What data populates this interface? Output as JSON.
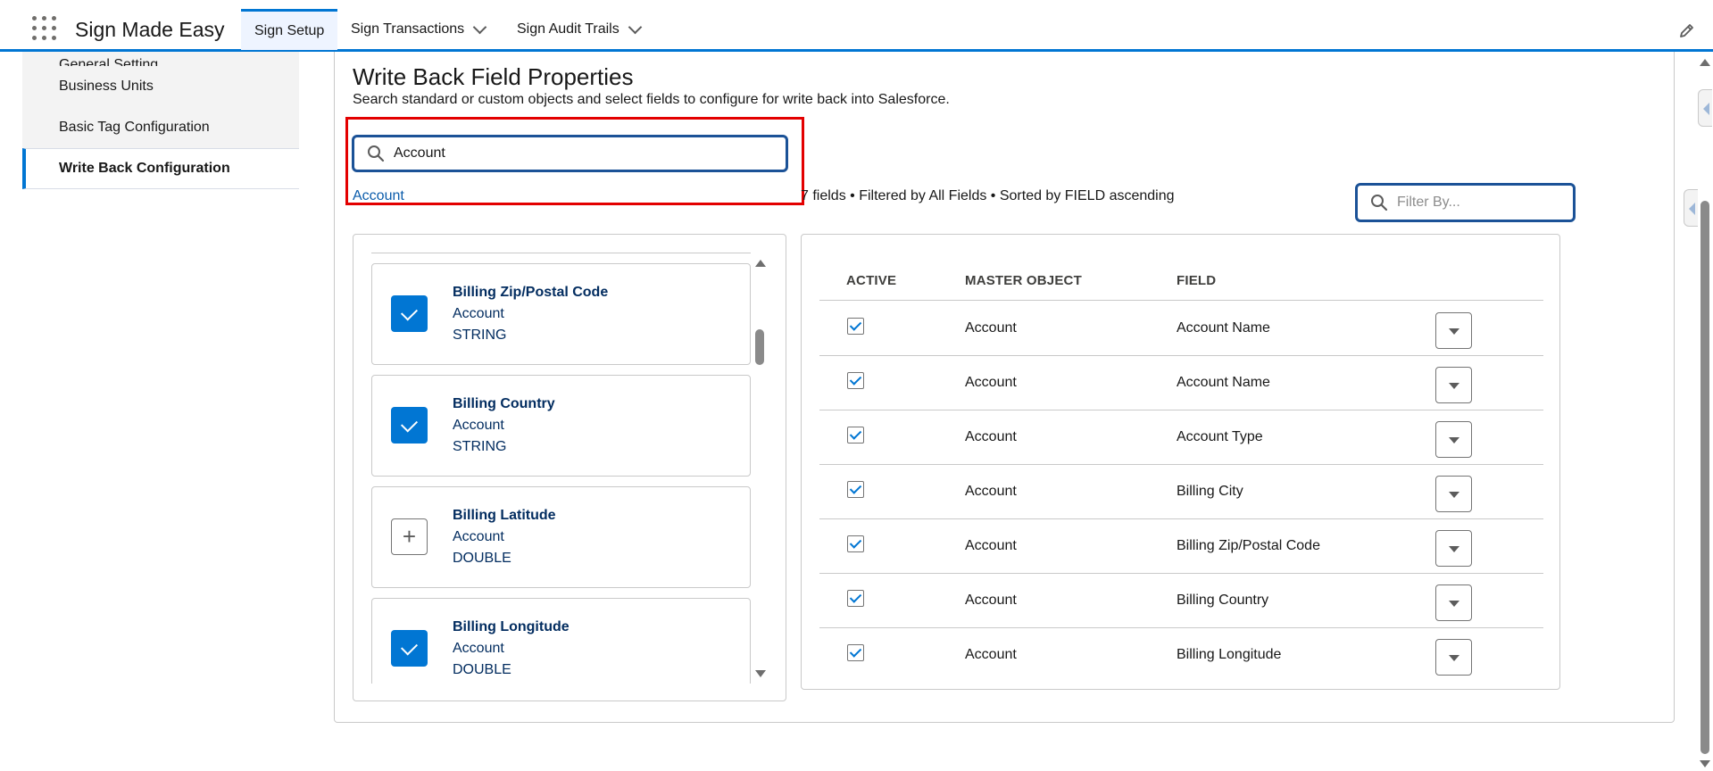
{
  "app": {
    "name": "Sign Made Easy"
  },
  "nav": {
    "tabs": [
      {
        "label": "Sign Setup",
        "active": true,
        "has_menu": false
      },
      {
        "label": "Sign Transactions",
        "active": false,
        "has_menu": true
      },
      {
        "label": "Sign Audit Trails",
        "active": false,
        "has_menu": true
      }
    ]
  },
  "sidebar": {
    "items": [
      {
        "label": "General Setting"
      },
      {
        "label": "Business Units"
      },
      {
        "label": "Basic Tag Configuration"
      },
      {
        "label": "Write Back Configuration",
        "active": true
      }
    ]
  },
  "page": {
    "title": "Write Back Field Properties",
    "description": "Search standard or custom objects and select fields to configure for write back into Salesforce."
  },
  "search": {
    "value": "Account",
    "suggestion": "Account"
  },
  "results": {
    "info": "7 fields • Filtered by All Fields • Sorted by FIELD ascending"
  },
  "filter": {
    "placeholder": "Filter By..."
  },
  "field_list": [
    {
      "name": "Billing Zip/Postal Code",
      "object": "Account",
      "type": "STRING",
      "selected": true
    },
    {
      "name": "Billing Country",
      "object": "Account",
      "type": "STRING",
      "selected": true
    },
    {
      "name": "Billing Latitude",
      "object": "Account",
      "type": "DOUBLE",
      "selected": false
    },
    {
      "name": "Billing Longitude",
      "object": "Account",
      "type": "DOUBLE",
      "selected": true
    }
  ],
  "table": {
    "columns": [
      "ACTIVE",
      "MASTER OBJECT",
      "FIELD"
    ],
    "rows": [
      {
        "active": true,
        "master_object": "Account",
        "field": "Account Name"
      },
      {
        "active": true,
        "master_object": "Account",
        "field": "Account Name"
      },
      {
        "active": true,
        "master_object": "Account",
        "field": "Account Type"
      },
      {
        "active": true,
        "master_object": "Account",
        "field": "Billing City"
      },
      {
        "active": true,
        "master_object": "Account",
        "field": "Billing Zip/Postal Code"
      },
      {
        "active": true,
        "master_object": "Account",
        "field": "Billing Country"
      },
      {
        "active": true,
        "master_object": "Account",
        "field": "Billing Longitude"
      }
    ]
  },
  "colors": {
    "brand_blue": "#0176d3",
    "input_border": "#1b5297",
    "highlight_red": "#e30000",
    "link_blue": "#0b5cab",
    "field_text": "#032d60"
  },
  "icons": [
    "app-launcher-icon",
    "chevron-down-icon",
    "edit-icon",
    "search-icon",
    "checkmark-icon",
    "add-icon",
    "dropdown-icon"
  ]
}
